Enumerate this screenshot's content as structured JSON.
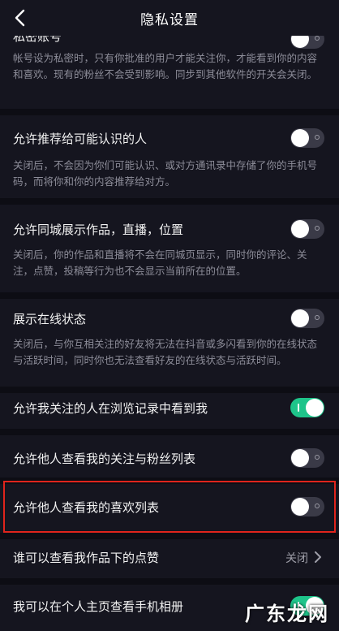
{
  "header": {
    "title": "隐私设置"
  },
  "private_account": {
    "label": "私密账号",
    "desc": "帐号设为私密时，只有你批准的用户才能关注你，才能看到你的内容和喜欢。现有的粉丝不会受到影响。同步到其他软件的开关会关闭。",
    "enabled": false
  },
  "recommend": {
    "label": "允许推荐给可能认识的人",
    "desc": "关闭后，不会因为你们可能认识、或对方通讯录中存储了你的手机号码，而将你和你的内容推荐给对方。",
    "enabled": false
  },
  "same_city": {
    "label": "允许同城展示作品，直播，位置",
    "desc": "关闭后，你的作品和直播将不会在同城页显示，同时你的评论、关注，点赞，投稿等行为也不会显示当前所在的位置。",
    "enabled": false
  },
  "online_status": {
    "label": "展示在线状态",
    "desc": "关闭后，与你互相关注的好友将无法在抖音或多闪看到你的在线状态与活跃时间，同时你也无法查看好友的在线状态与活跃时间。",
    "enabled": false
  },
  "browse_history": {
    "label": "允许我关注的人在浏览记录中看到我",
    "enabled": true
  },
  "follow_list": {
    "label": "允许他人查看我的关注与粉丝列表",
    "enabled": false
  },
  "likes_list": {
    "label": "允许他人查看我的喜欢列表",
    "enabled": false
  },
  "like_visibility": {
    "label": "谁可以查看我作品下的点赞",
    "value": "关闭"
  },
  "album": {
    "label": "我可以在个人主页查看手机相册",
    "enabled": true
  },
  "watermark": "广东龙网"
}
